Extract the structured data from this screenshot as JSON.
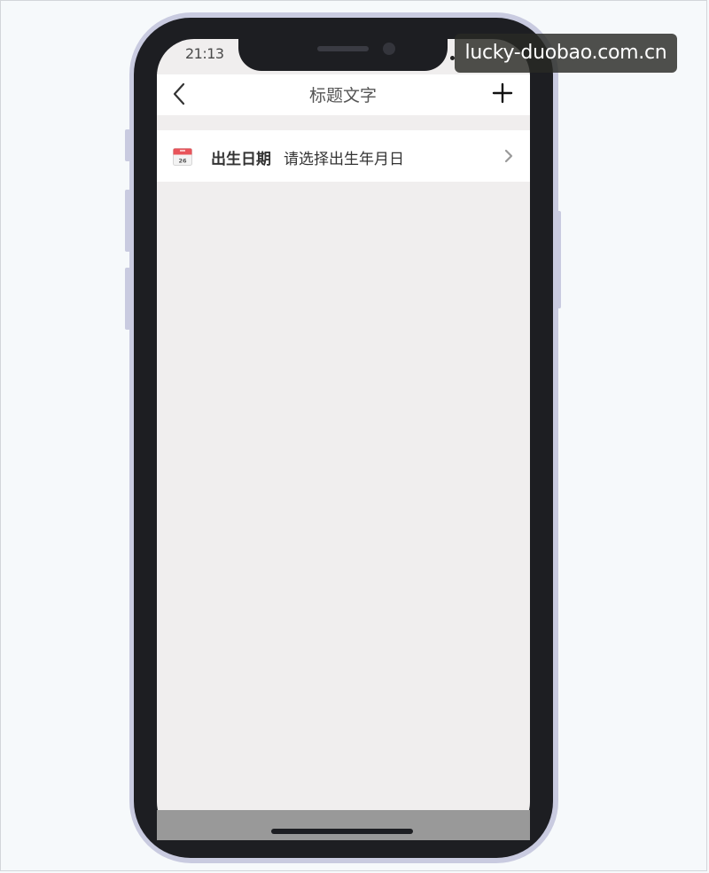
{
  "status_bar": {
    "time": "21:13"
  },
  "nav": {
    "title": "标题文字",
    "back_icon": "chevron-left-icon",
    "add_icon": "plus-icon"
  },
  "form": {
    "rows": [
      {
        "icon": "calendar-icon",
        "label": "出生日期",
        "placeholder": "请选择出生年月日",
        "trailing_icon": "chevron-right-icon"
      }
    ]
  },
  "calendar_icon_day": "26",
  "watermark": "lucky-duobao.com.cn",
  "colors": {
    "screen_background": "#f0eeee",
    "row_background": "#ffffff",
    "phone_frame": "#c9cbe0",
    "phone_body": "#1d1e22",
    "calendar_accent": "#e8545a",
    "home_area": "#999999"
  }
}
